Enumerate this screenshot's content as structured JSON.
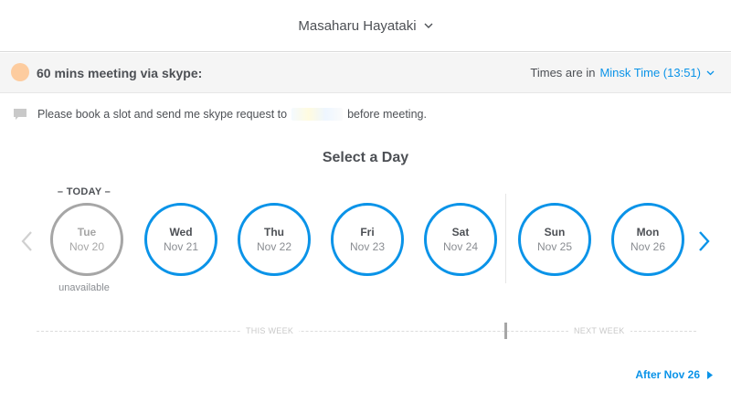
{
  "header": {
    "user_name": "Masaharu Hayataki"
  },
  "event": {
    "title": "60 mins meeting via skype:",
    "dot_color": "#fdcc9f",
    "timezone_prefix": "Times are in",
    "timezone_value": "Minsk Time (13:51)"
  },
  "note": {
    "text_before": "Please book a slot and send me skype request to",
    "text_after": "before meeting."
  },
  "calendar": {
    "title": "Select a Day",
    "today_label": "– TODAY –",
    "unavailable_label": "unavailable",
    "days": [
      {
        "name": "Tue",
        "date": "Nov 20",
        "available": false
      },
      {
        "name": "Wed",
        "date": "Nov 21",
        "available": true
      },
      {
        "name": "Thu",
        "date": "Nov 22",
        "available": true
      },
      {
        "name": "Fri",
        "date": "Nov 23",
        "available": true
      },
      {
        "name": "Sat",
        "date": "Nov 24",
        "available": true
      },
      {
        "name": "Sun",
        "date": "Nov 25",
        "available": true
      },
      {
        "name": "Mon",
        "date": "Nov 26",
        "available": true
      }
    ],
    "this_week_label": "THIS WEEK",
    "next_week_label": "NEXT WEEK",
    "after_link": "After Nov 26"
  },
  "colors": {
    "accent": "#0a93e8",
    "disabled": "#a6a6a6",
    "text": "#4d5055"
  }
}
